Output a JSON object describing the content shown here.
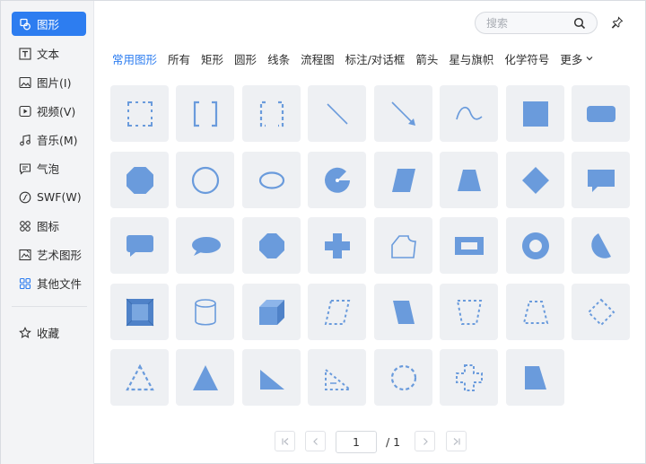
{
  "sidebar": {
    "items": [
      {
        "label": "图形",
        "icon": "shapes-icon",
        "active": true
      },
      {
        "label": "文本",
        "icon": "text-icon"
      },
      {
        "label": "图片(I)",
        "icon": "image-icon"
      },
      {
        "label": "视频(V)",
        "icon": "video-icon"
      },
      {
        "label": "音乐(M)",
        "icon": "music-icon"
      },
      {
        "label": "气泡",
        "icon": "bubble-icon"
      },
      {
        "label": "SWF(W)",
        "icon": "swf-icon"
      },
      {
        "label": "图标",
        "icon": "icon-grid-icon"
      },
      {
        "label": "艺术图形",
        "icon": "art-shape-icon"
      },
      {
        "label": "其他文件",
        "icon": "other-files-icon"
      }
    ],
    "favorites_label": "收藏"
  },
  "search": {
    "placeholder": "搜索"
  },
  "tabs": [
    {
      "label": "常用图形",
      "active": true
    },
    {
      "label": "所有"
    },
    {
      "label": "矩形"
    },
    {
      "label": "圆形"
    },
    {
      "label": "线条"
    },
    {
      "label": "流程图"
    },
    {
      "label": "标注/对话框"
    },
    {
      "label": "箭头"
    },
    {
      "label": "星与旗帜"
    },
    {
      "label": "化学符号"
    }
  ],
  "more_label": "更多",
  "shapes": [
    "dashed-square-bracket-frame",
    "square-brackets",
    "dashed-brackets",
    "line",
    "arrow-line",
    "curve",
    "filled-square",
    "rounded-rectangle",
    "octagon-rounded",
    "circle-outline",
    "ellipse-outline",
    "pie-circle",
    "parallelogram",
    "trapezoid",
    "diamond",
    "rect-callout",
    "rounded-callout",
    "oval-callout",
    "octagon",
    "plus-cross",
    "folded-corner-shape",
    "frame",
    "donut",
    "chord-shape",
    "bevel",
    "cylinder",
    "cube",
    "dashed-parallelogram",
    "parallelogram-2",
    "dashed-trapezoid-down",
    "dashed-trapezoid",
    "dashed-diamond",
    "dashed-triangle",
    "triangle",
    "right-triangle",
    "dashed-right-triangle",
    "dashed-circle",
    "dashed-cross",
    "quad-shape"
  ],
  "pagination": {
    "current": "1",
    "total": "/ 1"
  },
  "colors": {
    "accent": "#2d7df0",
    "shape_fill": "#6a9bdc",
    "shape_stroke": "#6a9bdc",
    "cell_bg": "#eef0f3"
  }
}
